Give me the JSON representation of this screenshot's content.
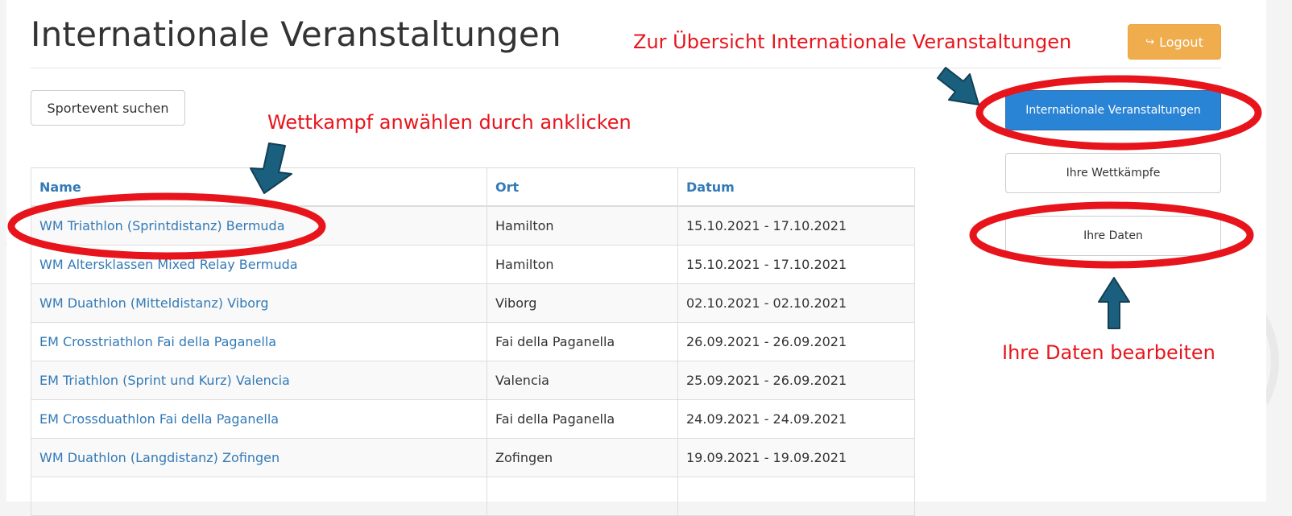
{
  "page": {
    "title": "Internationale Veranstaltungen"
  },
  "toolbar": {
    "logout_label": "Logout",
    "search_label": "Sportevent suchen"
  },
  "sidebar": {
    "items": [
      {
        "label": "Internationale Veranstaltungen",
        "active": true
      },
      {
        "label": "Ihre Wettkämpfe",
        "active": false
      },
      {
        "label": "Ihre Daten",
        "active": false
      }
    ]
  },
  "table": {
    "headers": {
      "name": "Name",
      "ort": "Ort",
      "datum": "Datum"
    },
    "rows": [
      {
        "name": "WM Triathlon (Sprintdistanz) Bermuda",
        "ort": "Hamilton",
        "datum": "15.10.2021 - 17.10.2021"
      },
      {
        "name": "WM Altersklassen Mixed Relay Bermuda",
        "ort": "Hamilton",
        "datum": "15.10.2021 - 17.10.2021"
      },
      {
        "name": "WM Duathlon (Mitteldistanz) Viborg",
        "ort": "Viborg",
        "datum": "02.10.2021 - 02.10.2021"
      },
      {
        "name": "EM Crosstriathlon Fai della Paganella",
        "ort": "Fai della Paganella",
        "datum": "26.09.2021 - 26.09.2021"
      },
      {
        "name": "EM Triathlon (Sprint und Kurz) Valencia",
        "ort": "Valencia",
        "datum": "25.09.2021 - 26.09.2021"
      },
      {
        "name": "EM Crossduathlon Fai della Paganella",
        "ort": "Fai della Paganella",
        "datum": "24.09.2021 - 24.09.2021"
      },
      {
        "name": "WM Duathlon (Langdistanz) Zofingen",
        "ort": "Zofingen",
        "datum": "19.09.2021 - 19.09.2021"
      },
      {
        "name": "",
        "ort": "",
        "datum": ""
      }
    ]
  },
  "annotations": {
    "overview": "Zur Übersicht Internationale Veranstaltungen",
    "select": "Wettkampf anwählen durch anklicken",
    "edit": "Ihre Daten bearbeiten"
  },
  "colors": {
    "link": "#337ab7",
    "primary": "#2a84d6",
    "warning": "#f0ad4e",
    "annotation": "#e8141c",
    "arrow": "#1b5f7e"
  }
}
